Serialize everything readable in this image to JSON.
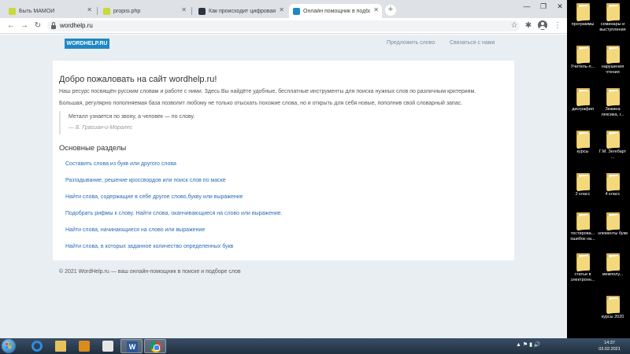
{
  "browser": {
    "tabs": [
      {
        "title": "Быть МАМОЙ",
        "favicon_color": "#c8d93a"
      },
      {
        "title": "propisi.php",
        "favicon_color": "#c8d93a"
      },
      {
        "title": "Как происходит цифровая тран",
        "favicon_color": "#2b3540"
      },
      {
        "title": "Онлайн помощник в подборе сл",
        "favicon_color": "#1e88c7"
      }
    ],
    "url": "wordhelp.ru",
    "icons": {
      "back": "arrow-left-icon",
      "forward": "arrow-right-icon",
      "reload": "reload-icon",
      "lock": "lock-icon",
      "bookmark": "star-icon",
      "extensions": "puzzle-icon",
      "profile": "avatar-icon",
      "menu": "kebab-menu-icon"
    }
  },
  "site": {
    "logo": "WORDHELP.RU",
    "nav": [
      "Предложить слово",
      "Связаться с нами"
    ],
    "title": "Добро пожаловать на сайт wordhelp.ru!",
    "intro": "Наш ресурс посвящён русским словам и работе с ними. Здесь Вы найдёте удобные, бесплатные инструменты для поиска нужных слов по различным критериям.",
    "intro2": "Большая, регулярно пополняемая база позволит любому не только отыскать похожие слова, но и открыть для себя новые, пополнив свой словарный запас.",
    "quote": "Металл узнается по звону, а человек — по слову.",
    "quote_author": "— Б. Грасиан-и-Моралес",
    "sections_title": "Основные разделы",
    "sections": [
      "Составить слова из букв или другого слова",
      "Разгадывание, решение кроссвордов или поиск слов по маске",
      "Найти слова, содержащие в себе другое слово,букву или выражение",
      "Подобрать рифмы к слову. Найти слова, оканчивающиеся на слово или выражение.",
      "Найти слова, начинающиеся на слово или выражение",
      "Найти слова, в которых заданное количество определенных букв"
    ],
    "footer": "© 2021 WordHelp.ru — ваш онлайн-помощник в поиске и подборе слов"
  },
  "desktop": {
    "icons": [
      {
        "label": "программы"
      },
      {
        "label": "семинары и выступления"
      },
      {
        "label": "Учитель-л..."
      },
      {
        "label": "нарушения чтения"
      },
      {
        "label": "дисграфия"
      },
      {
        "label": "Зюкина лексика, г..."
      },
      {
        "label": "курсы"
      },
      {
        "label": "Г.М. Зегебарт ..."
      },
      {
        "label": "2 класс"
      },
      {
        "label": "4 класс"
      },
      {
        "label": "тестирова... ошибок на..."
      },
      {
        "label": "элементы букв"
      },
      {
        "label": "статьи в электронн..."
      },
      {
        "label": "межполу..."
      },
      {
        "label": "курсы 2020"
      }
    ]
  },
  "taskbar": {
    "apps": [
      "ie-icon",
      "explorer-icon",
      "media-player-icon",
      "paint-icon",
      "word-icon",
      "chrome-icon"
    ],
    "time": "14:37",
    "date": "03.02.2021"
  }
}
